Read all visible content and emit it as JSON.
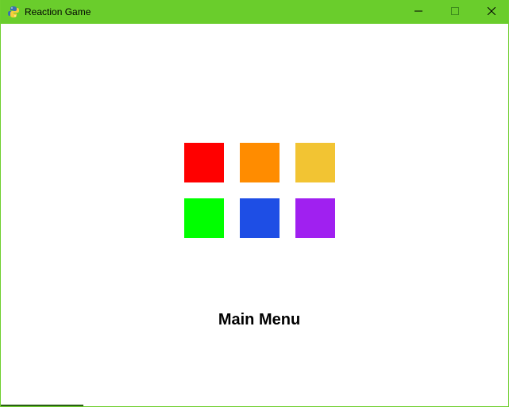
{
  "window": {
    "title": "Reaction Game",
    "title_bar_color": "#6acd2c",
    "icons": {
      "app": "python-snake-icon",
      "minimize": "minimize-icon",
      "maximize": "maximize-icon",
      "close": "close-icon"
    }
  },
  "game": {
    "tiles": [
      {
        "name": "red",
        "color": "#ff0000"
      },
      {
        "name": "orange",
        "color": "#ff8c00"
      },
      {
        "name": "yellow",
        "color": "#f2c433"
      },
      {
        "name": "green",
        "color": "#00ff00"
      },
      {
        "name": "blue",
        "color": "#1e4ee5"
      },
      {
        "name": "purple",
        "color": "#a020f0"
      }
    ],
    "menu_label": "Main Menu"
  }
}
